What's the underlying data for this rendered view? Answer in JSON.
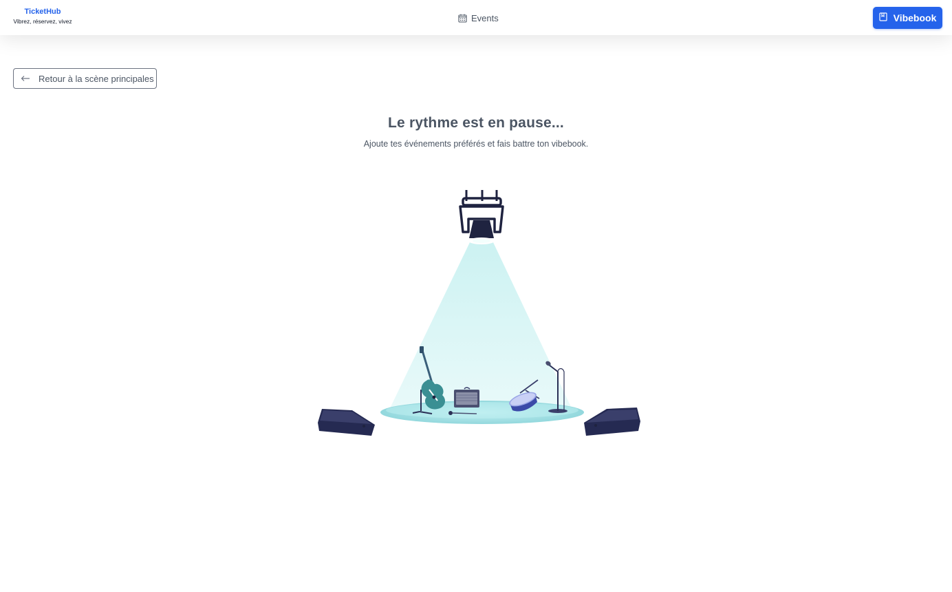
{
  "brand": {
    "name": "TicketHub",
    "tagline": "Vibrez, réservez, vivez"
  },
  "nav": {
    "events_label": "Events",
    "events_icon": "calendar-icon",
    "vibebook_label": "Vibebook",
    "vibebook_icon": "bookmark-icon"
  },
  "back_button": {
    "label": "Retour à la scène principales",
    "icon": "arrow-left-icon"
  },
  "empty_state": {
    "title": "Le rythme est en pause...",
    "subtitle": "Ajoute tes événements préférés et fais battre ton vibebook."
  },
  "colors": {
    "accent": "#2563eb",
    "spotlight": "#e0f7f7",
    "stage_floor": "#9edfe3",
    "dark_equipment": "#1f2340"
  }
}
